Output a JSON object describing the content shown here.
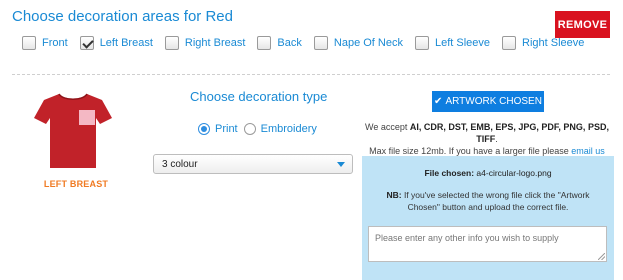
{
  "header": {
    "title": "Choose decoration areas for Red",
    "remove_label": "REMOVE"
  },
  "areas": [
    {
      "label": "Front",
      "checked": false
    },
    {
      "label": "Left Breast",
      "checked": true
    },
    {
      "label": "Right Breast",
      "checked": false
    },
    {
      "label": "Back",
      "checked": false
    },
    {
      "label": "Nape Of Neck",
      "checked": false
    },
    {
      "label": "Left Sleeve",
      "checked": false
    },
    {
      "label": "Right Sleeve",
      "checked": false
    }
  ],
  "garment": {
    "color": "#c12229",
    "highlight_color": "#f4b8c4",
    "label": "LEFT BREAST"
  },
  "decoration": {
    "title": "Choose decoration type",
    "options": [
      {
        "label": "Print",
        "selected": true
      },
      {
        "label": "Embroidery",
        "selected": false
      }
    ],
    "colours_value": "3 colour"
  },
  "artwork": {
    "button_label": "ARTWORK CHOSEN",
    "accept_prefix": "We accept",
    "formats": "AI, CDR, DST, EMB, EPS, JPG, PDF, PNG, PSD, TIFF",
    "accept_suffix": ".",
    "max_size_text": "Max file size 12mb. If you have a larger file please",
    "email_link": "email us",
    "file_chosen_label": "File chosen:",
    "file_name": "a4-circular-logo.png",
    "nb_label": "NB:",
    "nb_text": "If you've selected the wrong file click the \"Artwork Chosen\" button and upload the correct file.",
    "info_placeholder": "Please enter any other info you wish to supply"
  },
  "colors": {
    "accent": "#1a8ad4",
    "remove": "#d9121f",
    "artwork_button": "#0e7ee0",
    "panel": "#bfe3f6",
    "position_label": "#f07a22"
  }
}
